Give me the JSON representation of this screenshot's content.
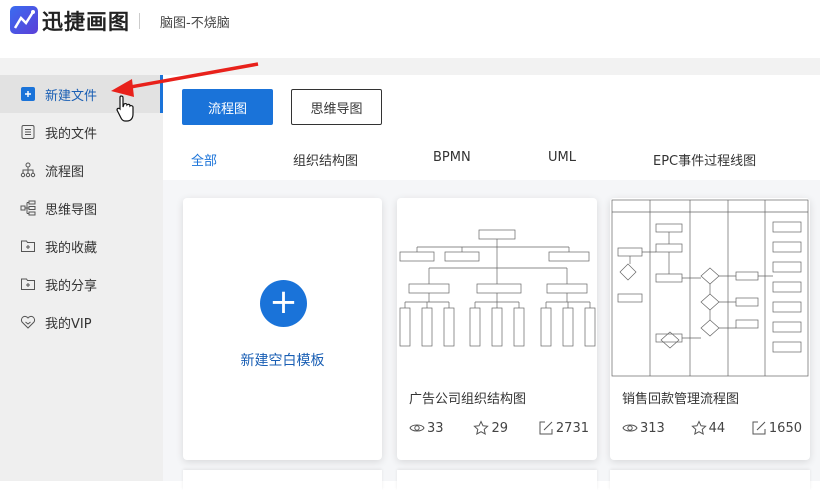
{
  "header": {
    "logo_text": "迅捷画图",
    "subtitle": "脑图-不烧脑"
  },
  "sidebar": {
    "items": [
      {
        "label": "新建文件",
        "icon": "new-file-icon"
      },
      {
        "label": "我的文件",
        "icon": "file-list-icon"
      },
      {
        "label": "流程图",
        "icon": "flowchart-icon"
      },
      {
        "label": "思维导图",
        "icon": "mindmap-icon"
      },
      {
        "label": "我的收藏",
        "icon": "folder-plus-icon"
      },
      {
        "label": "我的分享",
        "icon": "folder-plus-icon"
      },
      {
        "label": "我的VIP",
        "icon": "vip-heart-icon"
      }
    ]
  },
  "main": {
    "buttons": {
      "flowchart": "流程图",
      "mindmap": "思维导图"
    },
    "tabs": [
      "全部",
      "组织结构图",
      "BPMN",
      "UML",
      "EPC事件过程线图"
    ],
    "new_blank_label": "新建空白模板",
    "cards": [
      {
        "title": "广告公司组织结构图",
        "views": "33",
        "stars": "29",
        "edits": "2731"
      },
      {
        "title": "销售回款管理流程图",
        "views": "313",
        "stars": "44",
        "edits": "1650"
      }
    ]
  },
  "colors": {
    "accent": "#1a73d9",
    "arrow": "#e8211b"
  }
}
